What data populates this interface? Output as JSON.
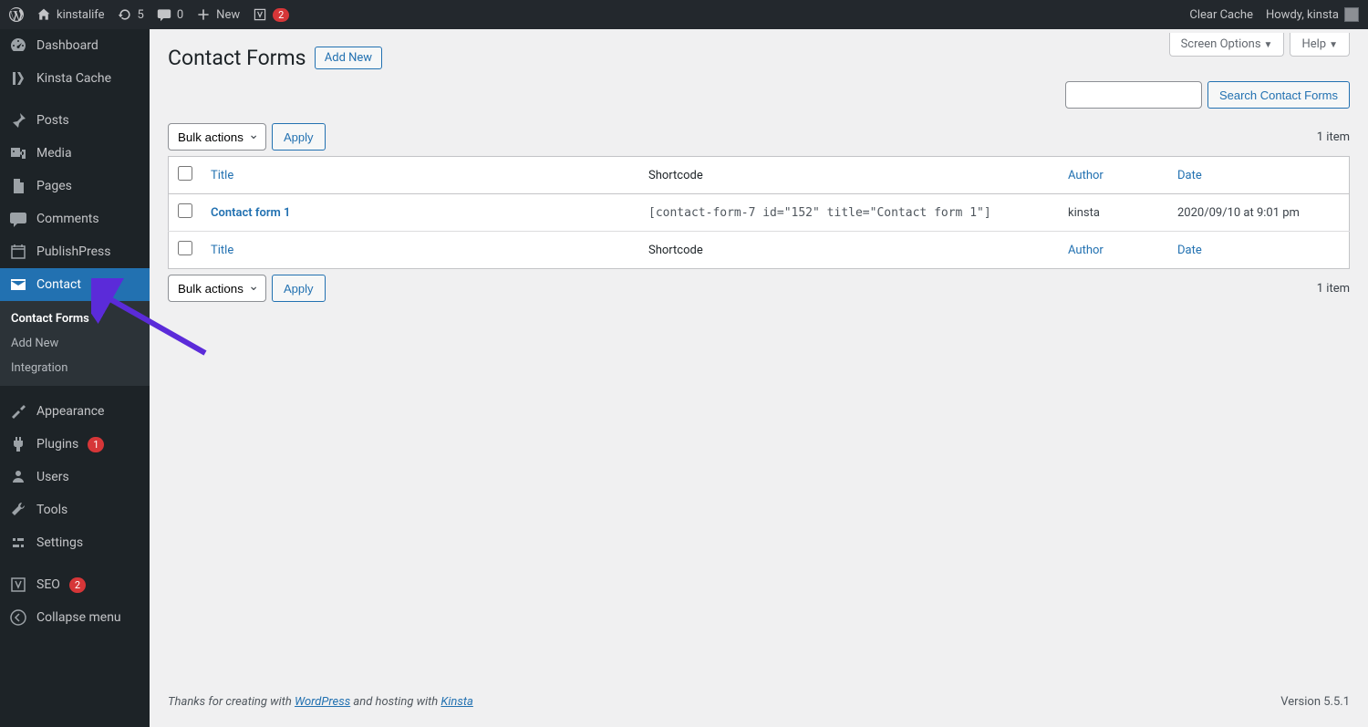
{
  "adminbar": {
    "site_name": "kinstalife",
    "refresh_count": "5",
    "comments_count": "0",
    "new_label": "New",
    "yoast_count": "2",
    "clear_cache": "Clear Cache",
    "howdy": "Howdy, kinsta"
  },
  "sidebar": {
    "dashboard": "Dashboard",
    "kinsta_cache": "Kinsta Cache",
    "posts": "Posts",
    "media": "Media",
    "pages": "Pages",
    "comments": "Comments",
    "publishpress": "PublishPress",
    "contact": "Contact",
    "contact_sub": {
      "forms": "Contact Forms",
      "add_new": "Add New",
      "integration": "Integration"
    },
    "appearance": "Appearance",
    "plugins": "Plugins",
    "plugins_count": "1",
    "users": "Users",
    "tools": "Tools",
    "settings": "Settings",
    "seo": "SEO",
    "seo_count": "2",
    "collapse": "Collapse menu"
  },
  "page": {
    "title": "Contact Forms",
    "add_new": "Add New",
    "screen_options": "Screen Options",
    "help": "Help",
    "search_button": "Search Contact Forms",
    "bulk_actions": "Bulk actions",
    "apply": "Apply",
    "item_count": "1 item"
  },
  "table": {
    "columns": {
      "title": "Title",
      "shortcode": "Shortcode",
      "author": "Author",
      "date": "Date"
    },
    "rows": [
      {
        "title": "Contact form 1",
        "shortcode": "[contact-form-7 id=\"152\" title=\"Contact form 1\"]",
        "author": "kinsta",
        "date": "2020/09/10 at 9:01 pm"
      }
    ]
  },
  "footer": {
    "thanks_prefix": "Thanks for creating with ",
    "wordpress": "WordPress",
    "hosting_mid": " and hosting with ",
    "kinsta": "Kinsta",
    "version": "Version 5.5.1"
  }
}
